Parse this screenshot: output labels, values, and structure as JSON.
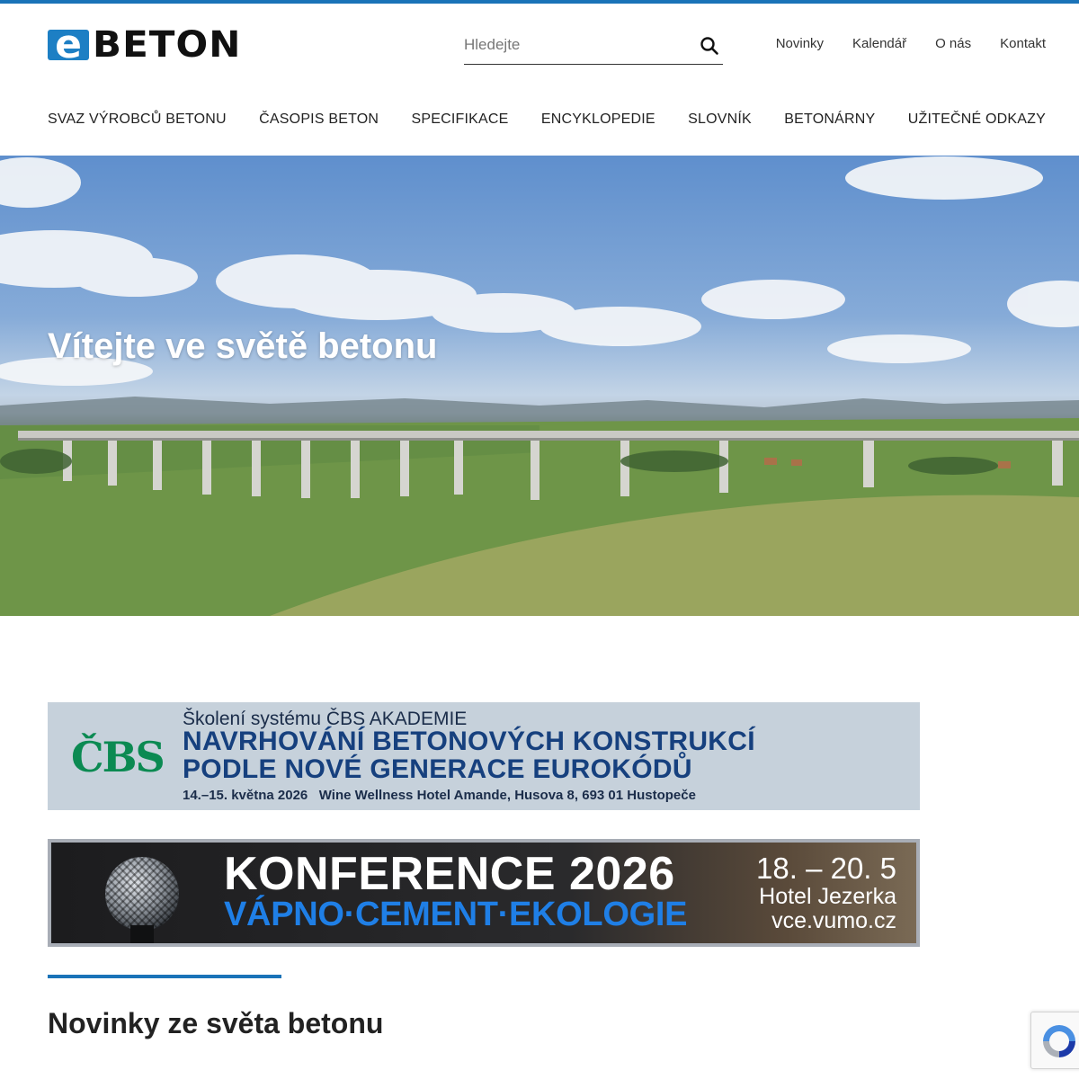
{
  "brand": {
    "logo_letter": "e",
    "logo_text": "BETON",
    "accent_color": "#1a73b8"
  },
  "search": {
    "placeholder": "Hledejte"
  },
  "top_links": [
    "Novinky",
    "Kalendář",
    "O nás",
    "Kontakt"
  ],
  "main_nav": [
    "SVAZ VÝROBCŮ BETONU",
    "ČASOPIS BETON",
    "SPECIFIKACE",
    "ENCYKLOPEDIE",
    "SLOVNÍK",
    "BETONÁRNY",
    "UŽITEČNÉ ODKAZY"
  ],
  "hero": {
    "title": "Vítejte ve světě betonu"
  },
  "banner_cbs": {
    "logo": "ČBS",
    "subtitle": "Školení systému ČBS AKADEMIE",
    "line1": "NAVRHOVÁNÍ BETONOVÝCH KONSTRUKCÍ",
    "line2": "PODLE NOVÉ GENERACE EUROKÓDŮ",
    "info": "14.–15. května 2026   Wine Wellness Hotel Amande, Husova 8, 693 01 Hustopeče"
  },
  "banner_conf": {
    "title": "KONFERENCE 2026",
    "subtitle": "VÁPNO·CEMENT·EKOLOGIE",
    "dates": "18. – 20. 5",
    "hotel": "Hotel Jezerka",
    "url": "vce.vumo.cz"
  },
  "section": {
    "title_bold": "Novinky",
    "title_rest": " ze světa betonu"
  }
}
